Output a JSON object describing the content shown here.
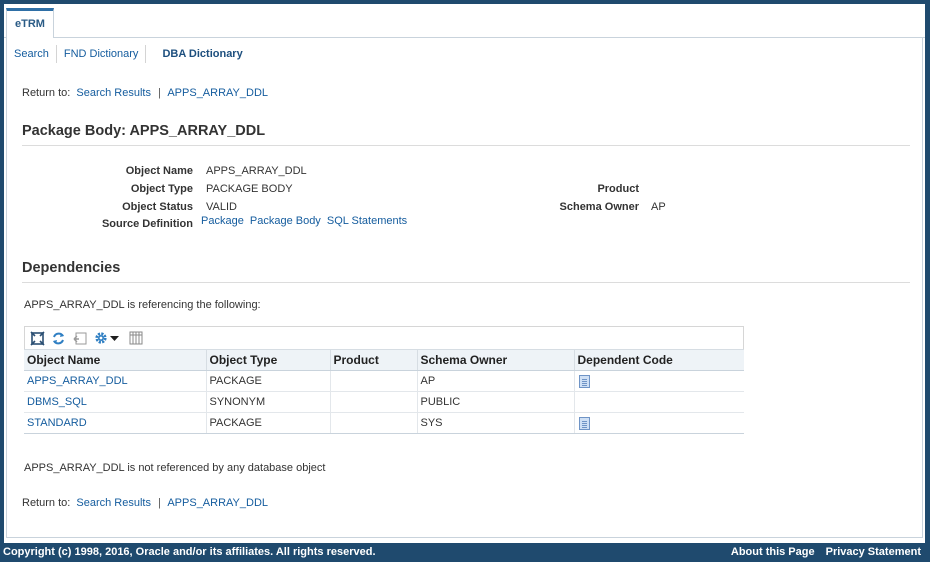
{
  "tab": {
    "label": "eTRM"
  },
  "subnav": {
    "search": "Search",
    "fnd": "FND Dictionary",
    "dba": "DBA Dictionary"
  },
  "return_to": {
    "label": "Return to:",
    "search_results": "Search Results",
    "separator": "|",
    "object": "APPS_ARRAY_DDL"
  },
  "page_title": "Package Body: APPS_ARRAY_DDL",
  "details": {
    "object_name_label": "Object Name",
    "object_name": "APPS_ARRAY_DDL",
    "object_type_label": "Object Type",
    "object_type": "PACKAGE BODY",
    "object_status_label": "Object Status",
    "object_status": "VALID",
    "source_def_label": "Source Definition",
    "source_links": [
      "Package",
      "Package Body",
      "SQL Statements"
    ],
    "product_label": "Product",
    "product": "",
    "schema_owner_label": "Schema Owner",
    "schema_owner": "AP"
  },
  "dependencies": {
    "title": "Dependencies",
    "referencing_text": "APPS_ARRAY_DDL is referencing the following:",
    "columns": [
      "Object Name",
      "Object Type",
      "Product",
      "Schema Owner",
      "Dependent Code"
    ],
    "rows": [
      {
        "name": "APPS_ARRAY_DDL",
        "type": "PACKAGE",
        "product": "",
        "owner": "AP",
        "has_code": true
      },
      {
        "name": "DBMS_SQL",
        "type": "SYNONYM",
        "product": "",
        "owner": "PUBLIC",
        "has_code": false
      },
      {
        "name": "STANDARD",
        "type": "PACKAGE",
        "product": "",
        "owner": "SYS",
        "has_code": true
      }
    ],
    "not_referenced_text": "APPS_ARRAY_DDL is not referenced by any database object"
  },
  "toolbar_icons": [
    "detach-icon",
    "refresh-icon",
    "reset-icon",
    "settings-icon",
    "dropdown-icon",
    "columns-icon"
  ],
  "footer": {
    "copyright": "Copyright (c) 1998, 2016, Oracle and/or its affiliates. All rights reserved.",
    "about": "About this Page",
    "privacy": "Privacy Statement"
  },
  "colors": {
    "brand": "#1f4a6e",
    "link": "#145c9e",
    "tab_accent": "#2e6fa6"
  }
}
